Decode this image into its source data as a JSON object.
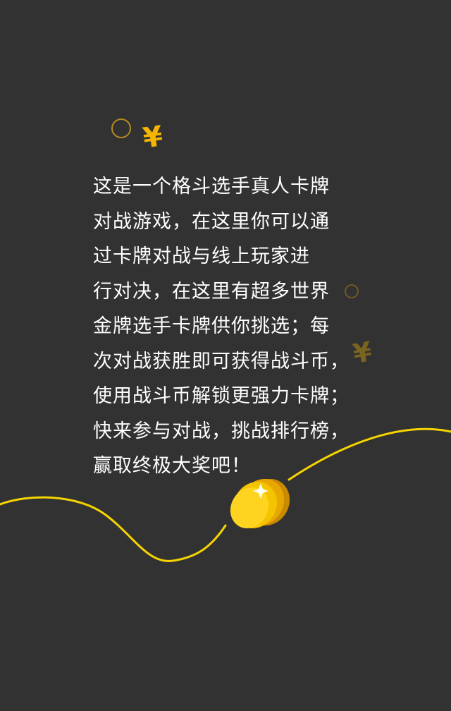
{
  "body_lines": [
    "这是一个格斗选手真人卡牌",
    "对战游戏，在这里你可以通",
    "过卡牌对战与线上玩家进",
    "行对决，在这里有超多世界",
    "金牌选手卡牌供你挑选；每",
    "次对战获胜即可获得战斗币，",
    "使用战斗币解锁更强力卡牌；",
    "快来参与对战，挑战排行榜，",
    "赢取终极大奖吧！"
  ],
  "symbols": {
    "yen_primary": "¥",
    "yen_secondary": "¥"
  },
  "colors": {
    "background": "#323232",
    "text": "#ffffff",
    "accent_yellow": "#f5d400",
    "coin_gold": "#f5b400"
  }
}
